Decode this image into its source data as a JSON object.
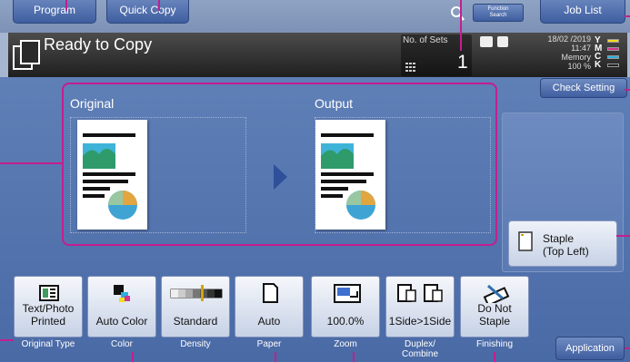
{
  "top": {
    "program": "Program",
    "quick_copy": "Quick Copy",
    "function_search": "Function\nSearch",
    "job_list": "Job List"
  },
  "status": {
    "title": "Ready to Copy",
    "sets_label": "No. of Sets",
    "sets_value": "1",
    "date": "18/02 /2019",
    "time": "11:47",
    "memory_label": "Memory",
    "memory_value": "100 %",
    "toner": [
      "Y",
      "M",
      "C",
      "K"
    ]
  },
  "check_setting": "Check Setting",
  "preview": {
    "original_label": "Original",
    "output_label": "Output"
  },
  "staple": {
    "line1": "Staple",
    "line2": "(Top Left)"
  },
  "buttons": [
    {
      "value": "Text/Photo\nPrinted",
      "caption": "Original Type"
    },
    {
      "value": "Auto Color",
      "caption": "Color"
    },
    {
      "value": "Standard",
      "caption": "Density"
    },
    {
      "value": "Auto",
      "caption": "Paper"
    },
    {
      "value": "100.0%",
      "caption": "Zoom"
    },
    {
      "value": "1Side>1Side",
      "caption": "Duplex/\nCombine"
    },
    {
      "value": "Do Not\nStaple",
      "caption": "Finishing"
    }
  ],
  "application": "Application",
  "colors": {
    "accent": "#c31f8e",
    "panel": "#4a6aa6",
    "yellow": "#f2dc1e",
    "magenta": "#d6338f",
    "cyan": "#2ab0e0"
  }
}
